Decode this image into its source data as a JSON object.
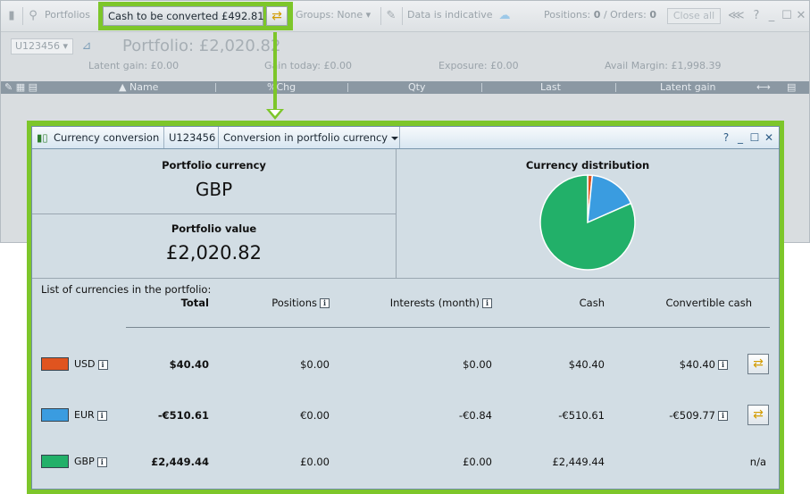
{
  "toolbar": {
    "portfolios_label": "Portfolios",
    "cash_to_convert": "Cash to be converted £492.81",
    "groups_label": "Groups: None",
    "data_indicative": "Data is indicative",
    "positions_label": "Positions:",
    "positions_count": "0",
    "orders_label": "/ Orders:",
    "orders_count": "0",
    "close_all": "Close all"
  },
  "portfolio": {
    "account": "U123456",
    "title": "Portfolio: £2,020.82",
    "latent_gain": "Latent gain: £0.00",
    "gain_today": "Gain today: £0.00",
    "exposure": "Exposure: £0.00",
    "avail_margin": "Avail Margin: £1,998.39"
  },
  "grid_columns": [
    "Name",
    "%Chg",
    "Qty",
    "Last",
    "Latent gain"
  ],
  "panel": {
    "title": "Currency conversion",
    "account": "U123456",
    "mode": "Conversion in portfolio currency",
    "portfolio_currency_label": "Portfolio currency",
    "portfolio_currency": "GBP",
    "portfolio_value_label": "Portfolio value",
    "portfolio_value": "£2,020.82",
    "distribution_label": "Currency distribution",
    "list_title": "List of currencies in the portfolio:",
    "columns": {
      "total": "Total",
      "positions": "Positions",
      "interests": "Interests (month)",
      "cash": "Cash",
      "convertible": "Convertible cash"
    },
    "rows": [
      {
        "currency": "USD",
        "color": "#e0541f",
        "total": "$40.40",
        "positions": "$0.00",
        "interests": "$0.00",
        "cash": "$40.40",
        "convertible": "$40.40"
      },
      {
        "currency": "EUR",
        "color": "#3a9ce0",
        "total": "-€510.61",
        "positions": "€0.00",
        "interests": "-€0.84",
        "cash": "-€510.61",
        "convertible": "-€509.77"
      },
      {
        "currency": "GBP",
        "color": "#22b069",
        "total": "£2,449.44",
        "positions": "£0.00",
        "interests": "£0.00",
        "cash": "£2,449.44",
        "convertible": "n/a"
      }
    ]
  },
  "pie_distribution": [
    {
      "currency": "USD",
      "share": 0.016,
      "color": "#e0541f"
    },
    {
      "currency": "EUR",
      "share": 0.168,
      "color": "#3a9ce0"
    },
    {
      "currency": "GBP",
      "share": 0.816,
      "color": "#22b069"
    }
  ]
}
